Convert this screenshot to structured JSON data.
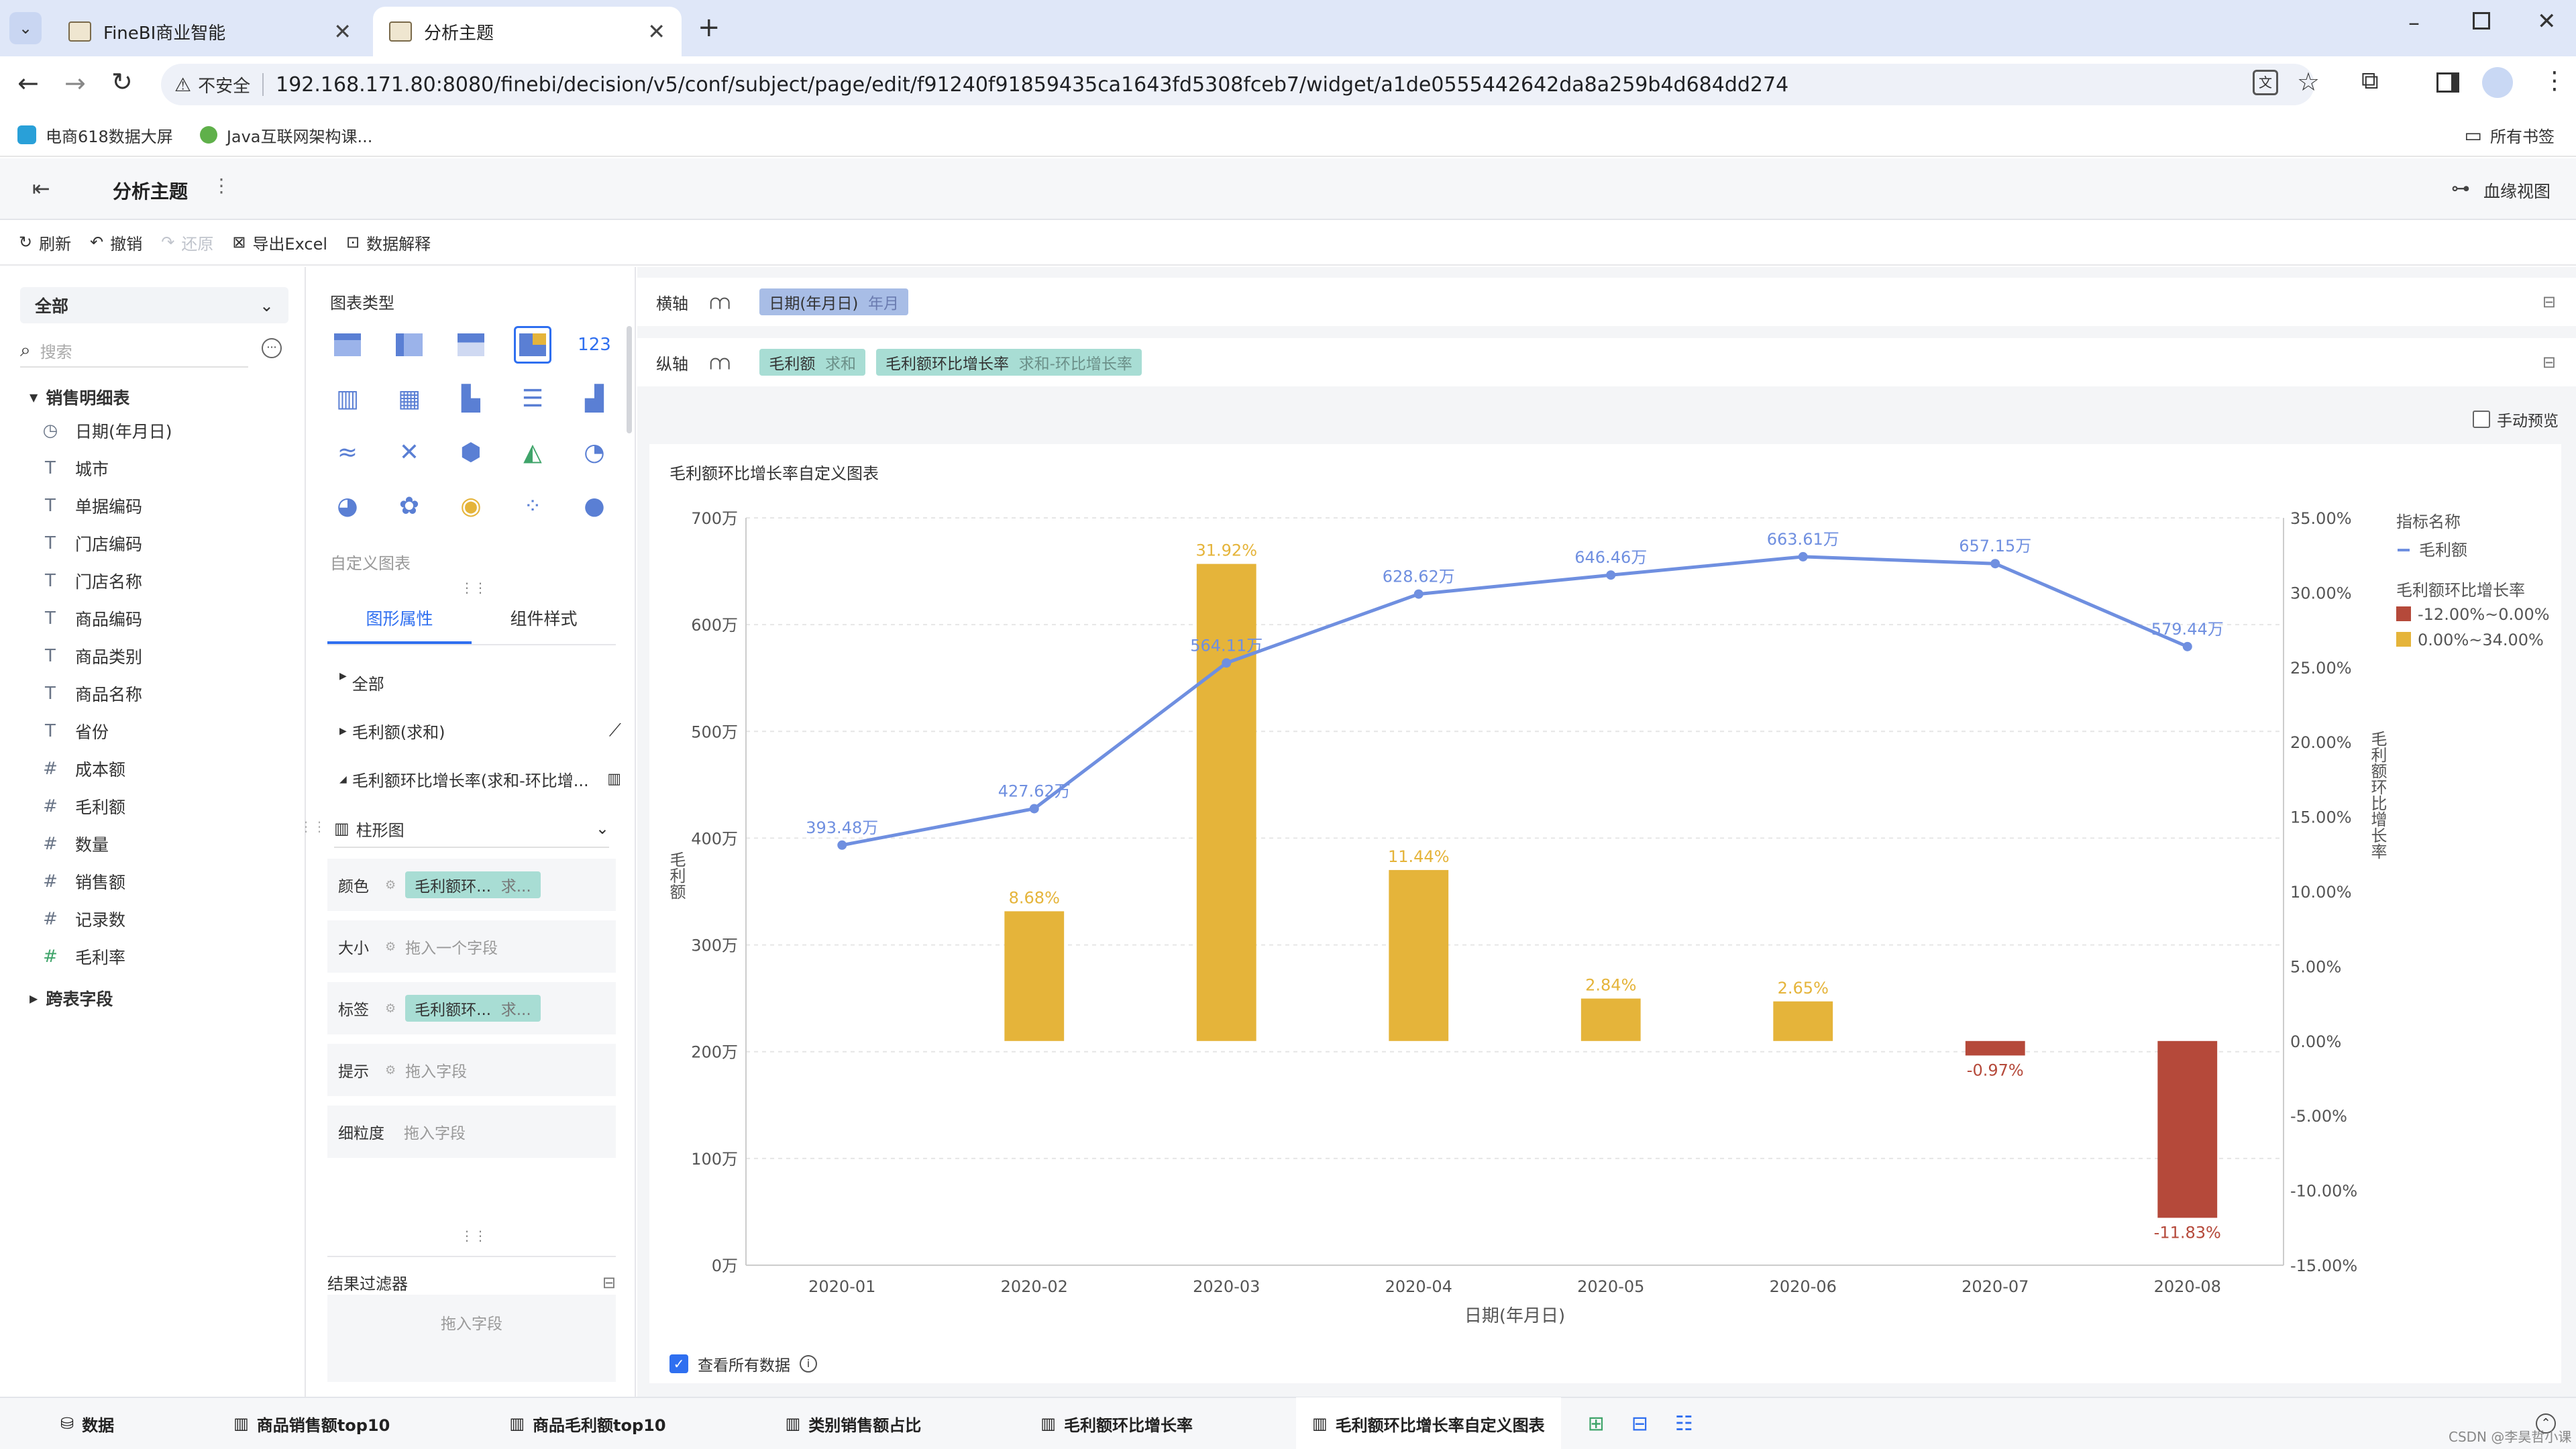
{
  "browser": {
    "tabs": [
      {
        "title": "FineBI商业智能",
        "active": false
      },
      {
        "title": "分析主题",
        "active": true
      }
    ],
    "security_label": "不安全",
    "url": "192.168.171.80:8080/finebi/decision/v5/conf/subject/page/edit/f91240f91859435ca1643fd5308fceb7/widget/a1de0555442642da8a259b4d684dd274",
    "bookmarks": [
      "电商618数据大屏",
      "Java互联网架构课..."
    ],
    "all_bookmarks": "所有书签"
  },
  "app": {
    "title": "分析主题",
    "lineage_view": "血缘视图",
    "toolbar": {
      "refresh": "刷新",
      "undo": "撤销",
      "redo": "还原",
      "export_excel": "导出Excel",
      "data_explain": "数据解释"
    }
  },
  "left_panel": {
    "scope": "全部",
    "search_placeholder": "搜索",
    "table_name": "销售明细表",
    "fields": [
      {
        "icon": "clock",
        "label": "日期(年月日)"
      },
      {
        "icon": "T",
        "label": "城市"
      },
      {
        "icon": "T",
        "label": "单据编码"
      },
      {
        "icon": "T",
        "label": "门店编码"
      },
      {
        "icon": "T",
        "label": "门店名称"
      },
      {
        "icon": "T",
        "label": "商品编码"
      },
      {
        "icon": "T",
        "label": "商品类别"
      },
      {
        "icon": "T",
        "label": "商品名称"
      },
      {
        "icon": "T",
        "label": "省份"
      },
      {
        "icon": "#",
        "label": "成本额"
      },
      {
        "icon": "#",
        "label": "毛利额"
      },
      {
        "icon": "#",
        "label": "数量"
      },
      {
        "icon": "#",
        "label": "销售额"
      },
      {
        "icon": "#",
        "label": "记录数"
      },
      {
        "icon": "#",
        "label": "毛利率"
      }
    ],
    "cross_table": "跨表字段"
  },
  "mid_panel": {
    "chart_type_title": "图表类型",
    "custom_chart": "自定义图表",
    "tabs": [
      "图形属性",
      "组件样式"
    ],
    "sections": {
      "all": "全部",
      "gross_profit": "毛利额(求和)",
      "growth_rate": "毛利额环比增长率(求和-环比增..."
    },
    "mark_type": "柱形图",
    "props": [
      {
        "label": "颜色",
        "value": "毛利额环...",
        "sub": "求..."
      },
      {
        "label": "大小",
        "value": "",
        "placeholder": "拖入一个字段"
      },
      {
        "label": "标签",
        "value": "毛利额环...",
        "sub": "求..."
      },
      {
        "label": "提示",
        "value": "",
        "placeholder": "拖入字段"
      },
      {
        "label": "细粒度",
        "value": "",
        "placeholder": "拖入字段"
      }
    ],
    "result_filter": "结果过滤器",
    "drag_field": "拖入字段"
  },
  "axes_panel": {
    "x_label": "横轴",
    "x_field": "日期(年月日)",
    "x_sub": "年月",
    "y_label": "纵轴",
    "y_fields": [
      {
        "name": "毛利额",
        "sub": "求和"
      },
      {
        "name": "毛利额环比增长率",
        "sub": "求和-环比增长率"
      }
    ],
    "manual_preview": "手动预览"
  },
  "chart_title": "毛利额环比增长率自定义图表",
  "view_all_data": "查看所有数据",
  "chart_data": {
    "type": "bar+line",
    "categories": [
      "2020-01",
      "2020-02",
      "2020-03",
      "2020-04",
      "2020-05",
      "2020-06",
      "2020-07",
      "2020-08"
    ],
    "xlabel": "日期(年月日)",
    "ylabel_left": "毛利额",
    "ylabel_right": "毛利额环比增长率",
    "left_axis": {
      "ticks": [
        "0万",
        "100万",
        "200万",
        "300万",
        "400万",
        "500万",
        "600万",
        "700万"
      ],
      "range": [
        0,
        700
      ]
    },
    "right_axis": {
      "ticks": [
        "-15.00%",
        "-10.00%",
        "-5.00%",
        "0.00%",
        "5.00%",
        "10.00%",
        "15.00%",
        "20.00%",
        "25.00%",
        "30.00%",
        "35.00%"
      ],
      "range": [
        -15,
        35
      ]
    },
    "line_series": {
      "name": "毛利额",
      "values": [
        393.48,
        427.62,
        564.11,
        628.62,
        646.46,
        663.61,
        657.15,
        579.44
      ],
      "labels": [
        "393.48万",
        "427.62万",
        "564.11万",
        "628.62万",
        "646.46万",
        "663.61万",
        "657.15万",
        "579.44万"
      ],
      "color": "#6f8fe0"
    },
    "bar_series": {
      "name": "毛利额环比增长率",
      "values": [
        null,
        8.68,
        31.92,
        11.44,
        2.84,
        2.65,
        -0.97,
        -11.83
      ],
      "labels": [
        "",
        "8.68%",
        "31.92%",
        "11.44%",
        "2.84%",
        "2.65%",
        "-0.97%",
        "-11.83%"
      ]
    },
    "legend": {
      "title1": "指标名称",
      "item1": "毛利额",
      "title2": "毛利额环比增长率",
      "ranges": [
        {
          "label": "-12.00%~0.00%",
          "color": "#b5493a"
        },
        {
          "label": "0.00%~34.00%",
          "color": "#e5b43a"
        }
      ]
    }
  },
  "bottom_tabs": [
    "数据",
    "商品销售额top10",
    "商品毛利额top10",
    "类别销售额占比",
    "毛利额环比增长率",
    "毛利额环比增长率自定义图表"
  ],
  "watermark": "CSDN @李昊哲小课"
}
